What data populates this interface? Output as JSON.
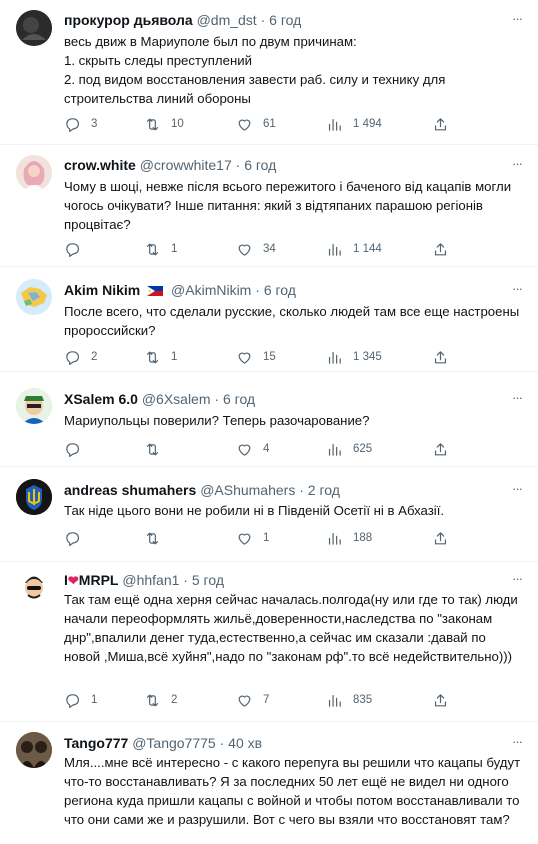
{
  "tweets": [
    {
      "name": "прокурор дьявола",
      "handle": "@dm_dst",
      "dot": "·",
      "time": "6 год",
      "text": "весь движ в Мариуполе был по двум причинам:\n1. скрыть следы преступлений\n2. под видом восстановления завести раб. силу и технику для строительства линий обороны",
      "replies": "3",
      "retweets": "10",
      "likes": "61",
      "views": "1 494",
      "more": "···"
    },
    {
      "name": "crow.white",
      "handle": "@crowwhite17",
      "dot": "·",
      "time": "6 год",
      "text": "Чому в шоці, невже після всього пережитого і баченого від кацапів могли чогось очікувати?  Інше питання: який з відтяпаних парашою регіонів процвітає?",
      "replies": "",
      "retweets": "1",
      "likes": "34",
      "views": "1 144",
      "more": "···"
    },
    {
      "name": "Akim Nikim",
      "handle": "@AkimNikim",
      "dot": "·",
      "time": "6 год",
      "text": "После всего, что сделали русские, сколько людей там все еще настроены пророссийски?",
      "replies": "2",
      "retweets": "1",
      "likes": "15",
      "views": "1 345",
      "more": "···"
    },
    {
      "name": "XSalem 6.0",
      "handle": "@6Xsalem",
      "dot": "·",
      "time": "6 год",
      "text": "Мариупольцы поверили? Теперь разочарование?",
      "replies": "",
      "retweets": "",
      "likes": "4",
      "views": "625",
      "more": "···"
    },
    {
      "name": "andreas shumahers",
      "handle": "@AShumahers",
      "dot": "·",
      "time": "2 год",
      "text": "Так ніде цього вони не робили ні в Південій Осетії ні в Абхазії.",
      "replies": "",
      "retweets": "",
      "likes": "1",
      "views": "188",
      "more": "···"
    },
    {
      "name_prefix": "I",
      "name_suffix": "MRPL",
      "handle": "@hhfan1",
      "dot": "·",
      "time": "5 год",
      "text": "Так там ещё одна херня сейчас началась.полгода(ну или где то так) люди начали переоформлять жильё,доверенности,наследства по \"законам днр\",впалили денег туда,естественно,а сейчас им сказали :давай по новой ,Миша,всё хуйня\",надо по \"законам рф\".то всё недействительно)))",
      "replies": "1",
      "retweets": "2",
      "likes": "7",
      "views": "835",
      "more": "···"
    },
    {
      "name": "Tango777",
      "handle": "@Tango7775",
      "dot": "·",
      "time": "40 хв",
      "text": "Мля....мне всё интересно - с какого перепуга вы решили что кацапы будут что-то восстанавливать? Я за последних 50 лет ещё не видел ни одного региона куда пришли кацапы с войной и чтобы потом восстанавливали то что они сами же и разрушили. Вот с чего вы взяли что восстановят там?",
      "more": "···"
    }
  ],
  "colors": {
    "text": "#0f1419",
    "secondary": "#536471",
    "divider": "#eff3f4",
    "heart": "#e0245e"
  },
  "icons": [
    "reply-icon",
    "retweet-icon",
    "like-icon",
    "views-icon",
    "share-icon",
    "more-icon"
  ]
}
